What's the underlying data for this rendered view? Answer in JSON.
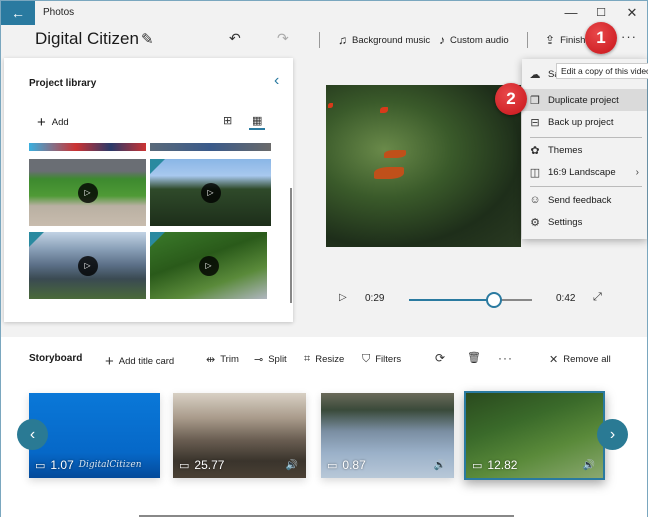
{
  "window": {
    "app_name": "Photos",
    "back_icon": "←",
    "minimize_icon": "—",
    "maximize_icon": "☐",
    "close_icon": "✕"
  },
  "toolbar": {
    "project_title": "Digital Citizen",
    "pencil_icon": "✎",
    "undo_icon": "↶",
    "redo_icon": "↷",
    "background_music": "Background music",
    "background_music_icon": "♫",
    "custom_audio": "Custom audio",
    "custom_audio_icon": "♪",
    "finish_video": "Finish video",
    "finish_video_icon": "⇪",
    "more_icon": "···"
  },
  "annotations": {
    "badge1": "1",
    "badge2": "2"
  },
  "library": {
    "title": "Project library",
    "collapse_icon": "‹",
    "add_label": "Add",
    "add_icon": "+",
    "view_large_icon": "⊞",
    "view_small_icon": "▦",
    "play_icon": "▷"
  },
  "playback": {
    "play_icon": "▷",
    "current_time": "0:29",
    "end_time": "0:42",
    "progress_fraction": 0.69,
    "fullscreen_icon": "⤢"
  },
  "menu": {
    "tooltip": "Edit a copy of this video",
    "items": [
      {
        "label": "Save to cloud",
        "icon": "☁"
      },
      {
        "label": "Duplicate project",
        "icon": "❐"
      },
      {
        "label": "Back up project",
        "icon": "⊟"
      },
      {
        "label": "Themes",
        "icon": "✿"
      },
      {
        "label": "16:9 Landscape",
        "icon": "◫",
        "chevron": "›"
      },
      {
        "label": "Send feedback",
        "icon": "☺"
      },
      {
        "label": "Settings",
        "icon": "⚙"
      }
    ]
  },
  "storyboard": {
    "title": "Storyboard",
    "add_title_card": "Add title card",
    "add_icon": "+",
    "trim": "Trim",
    "trim_icon": "⇹",
    "split": "Split",
    "split_icon": "⊸",
    "resize": "Resize",
    "resize_icon": "⌗",
    "filters": "Filters",
    "filters_icon": "⛉",
    "motion_icon": "⟳",
    "delete_icon": "🗑",
    "more_icon": "···",
    "remove_all": "Remove all",
    "remove_icon": "✕",
    "prev_icon": "‹",
    "next_icon": "›",
    "clips": [
      {
        "duration": "1.07",
        "type_icon": "▭",
        "watermark": "DigitalCitizen"
      },
      {
        "duration": "25.77",
        "type_icon": "▭",
        "sound_icon": "🔊"
      },
      {
        "duration": "0.87",
        "type_icon": "▭",
        "sound_icon": "🔊"
      },
      {
        "duration": "12.82",
        "type_icon": "▭",
        "sound_icon": "🔊"
      }
    ]
  }
}
